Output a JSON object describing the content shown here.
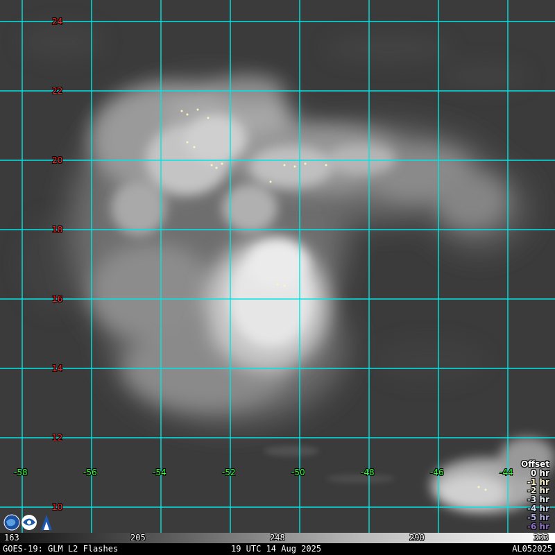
{
  "latitudes": [
    "24",
    "22",
    "20",
    "18",
    "16",
    "14",
    "12",
    "10"
  ],
  "longitudes": [
    "-58",
    "-56",
    "-54",
    "-52",
    "-50",
    "-48",
    "-46",
    "-44"
  ],
  "offset_legend": {
    "title": "Offset",
    "items": [
      {
        "label": "0 hr",
        "color": "#ffffff"
      },
      {
        "label": "-1 hr",
        "color": "#fff6c8"
      },
      {
        "label": "-2 hr",
        "color": "#f2f2d8"
      },
      {
        "label": "-3 hr",
        "color": "#e0ecec"
      },
      {
        "label": "-4 hr",
        "color": "#c8dcf2"
      },
      {
        "label": "-5 hr",
        "color": "#b0a8e0"
      },
      {
        "label": "-6 hr",
        "color": "#9070c8"
      }
    ]
  },
  "colorbar": {
    "ticks": [
      "163",
      "205",
      "248",
      "290",
      "333"
    ]
  },
  "footer": {
    "product": "GOES-19: GLM L2 Flashes",
    "timestamp": "19 UTC 14 Aug 2025",
    "storm_id": "AL052025"
  },
  "colors": {
    "grid": "#00e5e5",
    "lat_label": "#ff2020",
    "lon_label": "#30ff30"
  },
  "icons": [
    "nasa-globe-logo",
    "noaa-logo",
    "cira-logo"
  ]
}
